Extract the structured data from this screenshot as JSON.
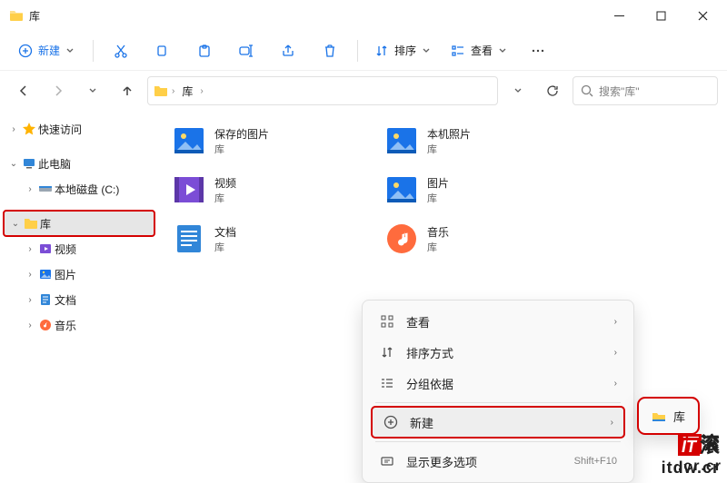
{
  "window": {
    "title": "库"
  },
  "toolbar": {
    "new": "新建",
    "sort": "排序",
    "view": "查看"
  },
  "address": {
    "root": "库"
  },
  "search": {
    "placeholder": "搜索\"库\""
  },
  "sidebar": {
    "quick": "快速访问",
    "this_pc": "此电脑",
    "local_disk": "本地磁盘 (C:)",
    "libraries": "库",
    "videos": "视频",
    "pictures": "图片",
    "documents": "文档",
    "music": "音乐"
  },
  "libs": {
    "sub": "库",
    "saved_pictures": "保存的图片",
    "camera_roll": "本机照片",
    "videos": "视频",
    "pictures": "图片",
    "documents": "文档",
    "music": "音乐"
  },
  "ctx": {
    "view": "查看",
    "sort": "排序方式",
    "group": "分组依据",
    "new": "新建",
    "more": "显示更多选项",
    "more_shortcut": "Shift+F10"
  },
  "submenu": {
    "library": "库"
  },
  "watermark": ".cr",
  "watermark_it": "IT"
}
